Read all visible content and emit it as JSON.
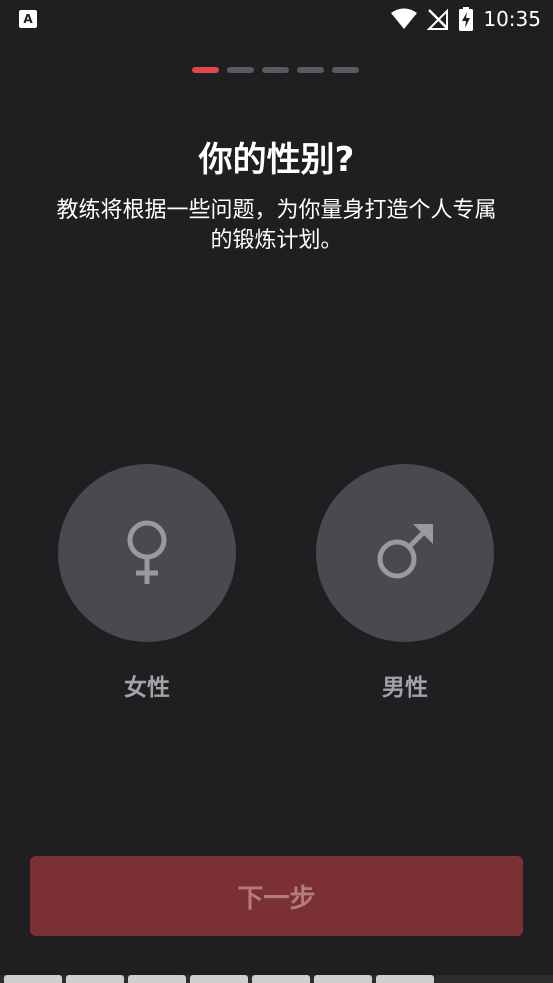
{
  "status_bar": {
    "app_icon_letter": "A",
    "time": "10:35",
    "icons": [
      "wifi-icon",
      "no-signal-icon",
      "battery-charging-icon"
    ]
  },
  "progress": {
    "total_steps": 5,
    "current_step": 1
  },
  "page": {
    "title": "你的性别?",
    "subtitle": "教练将根据一些问题，为你量身打造个人专属的锻炼计划。"
  },
  "options": {
    "female": {
      "label": "女性",
      "icon": "female-symbol-icon"
    },
    "male": {
      "label": "男性",
      "icon": "male-symbol-icon"
    }
  },
  "next_button": {
    "label": "下一步",
    "state": "disabled"
  },
  "colors": {
    "background": "#1f1e21",
    "accent": "#e0474c",
    "circle": "#4a494d",
    "button_disabled": "#7b3134"
  }
}
